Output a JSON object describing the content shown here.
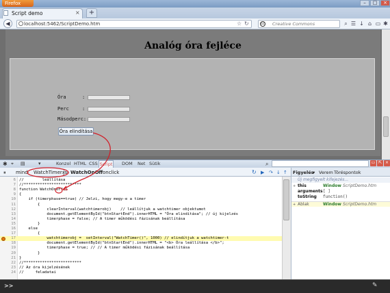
{
  "browser": {
    "app_button": "Firefox",
    "tab_title": "Script demo",
    "url": "localhost:5462/ScriptDemo.htm",
    "search_placeholder": "Creative Commons",
    "search_engine_icon": "creative-commons-icon",
    "new_tab_label": "+"
  },
  "page": {
    "heading": "Analóg óra fejléce",
    "fields": [
      {
        "label": "Óra",
        "colon": ":"
      },
      {
        "label": "Perc",
        "colon": ":"
      },
      {
        "label": "Másodperc:",
        "colon": ""
      }
    ],
    "start_button": "Óra elindítása"
  },
  "firebug": {
    "tabs": [
      "Konzol",
      "HTML",
      "CSS",
      "Script",
      "DOM",
      "Net",
      "Sütik"
    ],
    "active_tab": "Script",
    "breadcrumbs": [
      "mind",
      "WatchTimer.js",
      "WatchOnOff",
      "onclick"
    ],
    "right_tabs": [
      "Figyelés",
      "Verem",
      "Töréspontok"
    ],
    "new_watch_placeholder": "Új megfigyelt kifejezés...",
    "watch_rows": [
      {
        "name": "this",
        "value": "Window",
        "value_detail": "ScriptDemo.htm",
        "type": "window"
      },
      {
        "name": "arguments",
        "value": "[ ]",
        "value_detail": "",
        "type": "plain"
      },
      {
        "name": "toString",
        "value": "function()",
        "value_detail": "",
        "type": "plain"
      },
      {
        "name": "Ablak",
        "value": "Window",
        "value_detail": "ScriptDemo.htm",
        "type": "window"
      }
    ],
    "code_lines": [
      {
        "n": "6",
        "t": "//        leállítása"
      },
      {
        "n": "7",
        "t": "//*************************"
      },
      {
        "n": "8",
        "t": "function WatchOnOff()"
      },
      {
        "n": "9",
        "t": "{"
      },
      {
        "n": "10",
        "t": "    if (timerphase==true) // Jelzi, hogy megy-e a timer"
      },
      {
        "n": "11",
        "t": "        {"
      },
      {
        "n": "12",
        "t": "            clearInterval(watchtimerobj)    // leállítjuk a watchtimer objektumot"
      },
      {
        "n": "13",
        "t": "            document.getElementById(\"btnStartEnd\").innerHTML = \"Óra elindítása\"; // új kijelzés"
      },
      {
        "n": "14",
        "t": "            timerphase = false; // A timer működési fázisának beállítása"
      },
      {
        "n": "15",
        "t": "        }"
      },
      {
        "n": "16",
        "t": "    else"
      },
      {
        "n": "17",
        "t": "        {"
      },
      {
        "n": "17",
        "t": "            watchtimerobj =  setInterval(\"WatchTimer()\", 1000) // elindítjuk a watchtimer-t"
      },
      {
        "n": "18",
        "t": "            document.getElementById(\"btnStartEnd\").innerHTML = \"<b> Óra leállítása </b>\";"
      },
      {
        "n": "19",
        "t": "            timerphase = true; // // A timer működési fázisának beállítása"
      },
      {
        "n": "20",
        "t": "        }"
      },
      {
        "n": "21",
        "t": "}"
      },
      {
        "n": "22",
        "t": "//*************************"
      },
      {
        "n": "23",
        "t": "// Az óra kijelzésének"
      },
      {
        "n": "24",
        "t": "//     feladatai"
      }
    ],
    "command_prompt": ">>"
  },
  "colors": {
    "annotation": "#d0202a",
    "page_bg": "#7b7b7b",
    "form_bg": "#b3b3b3",
    "highlight_line": "#fffbb0"
  }
}
